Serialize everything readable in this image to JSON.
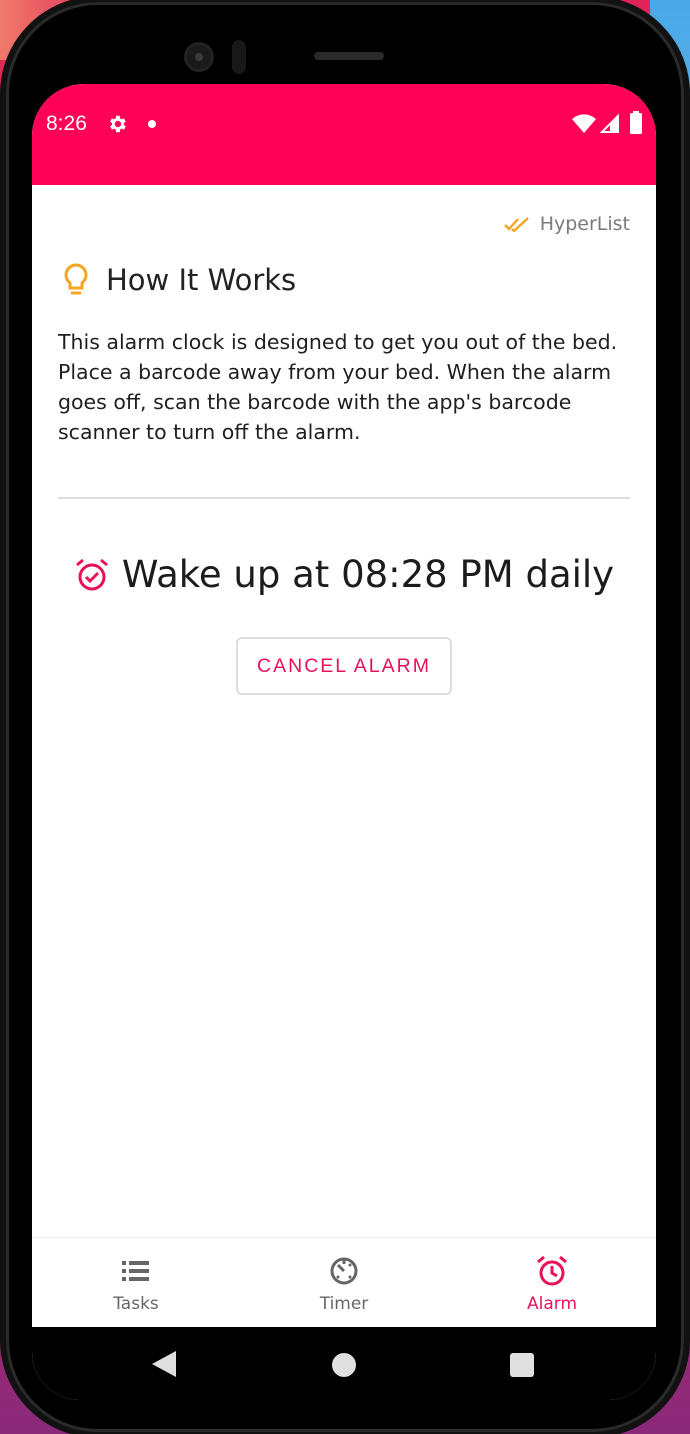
{
  "status": {
    "time": "8:26"
  },
  "brand": {
    "name": "HyperList"
  },
  "how_it_works": {
    "title": "How It Works",
    "text": "This alarm clock is designed to get you out of the bed. Place a barcode away from your bed. When the alarm goes off, scan the barcode with the app's barcode scanner to turn off the alarm."
  },
  "alarm": {
    "wake_text": "Wake up at 08:28 PM daily",
    "cancel_label": "CANCEL ALARM"
  },
  "bottom_nav": {
    "items": [
      {
        "label": "Tasks",
        "icon": "list-icon"
      },
      {
        "label": "Timer",
        "icon": "timer-icon"
      },
      {
        "label": "Alarm",
        "icon": "alarm-icon",
        "active": true
      }
    ]
  },
  "colors": {
    "accent": "#ff0157",
    "accent_text": "#e8115a",
    "bulb": "#f5a623",
    "brand_check": "#f5a623"
  }
}
